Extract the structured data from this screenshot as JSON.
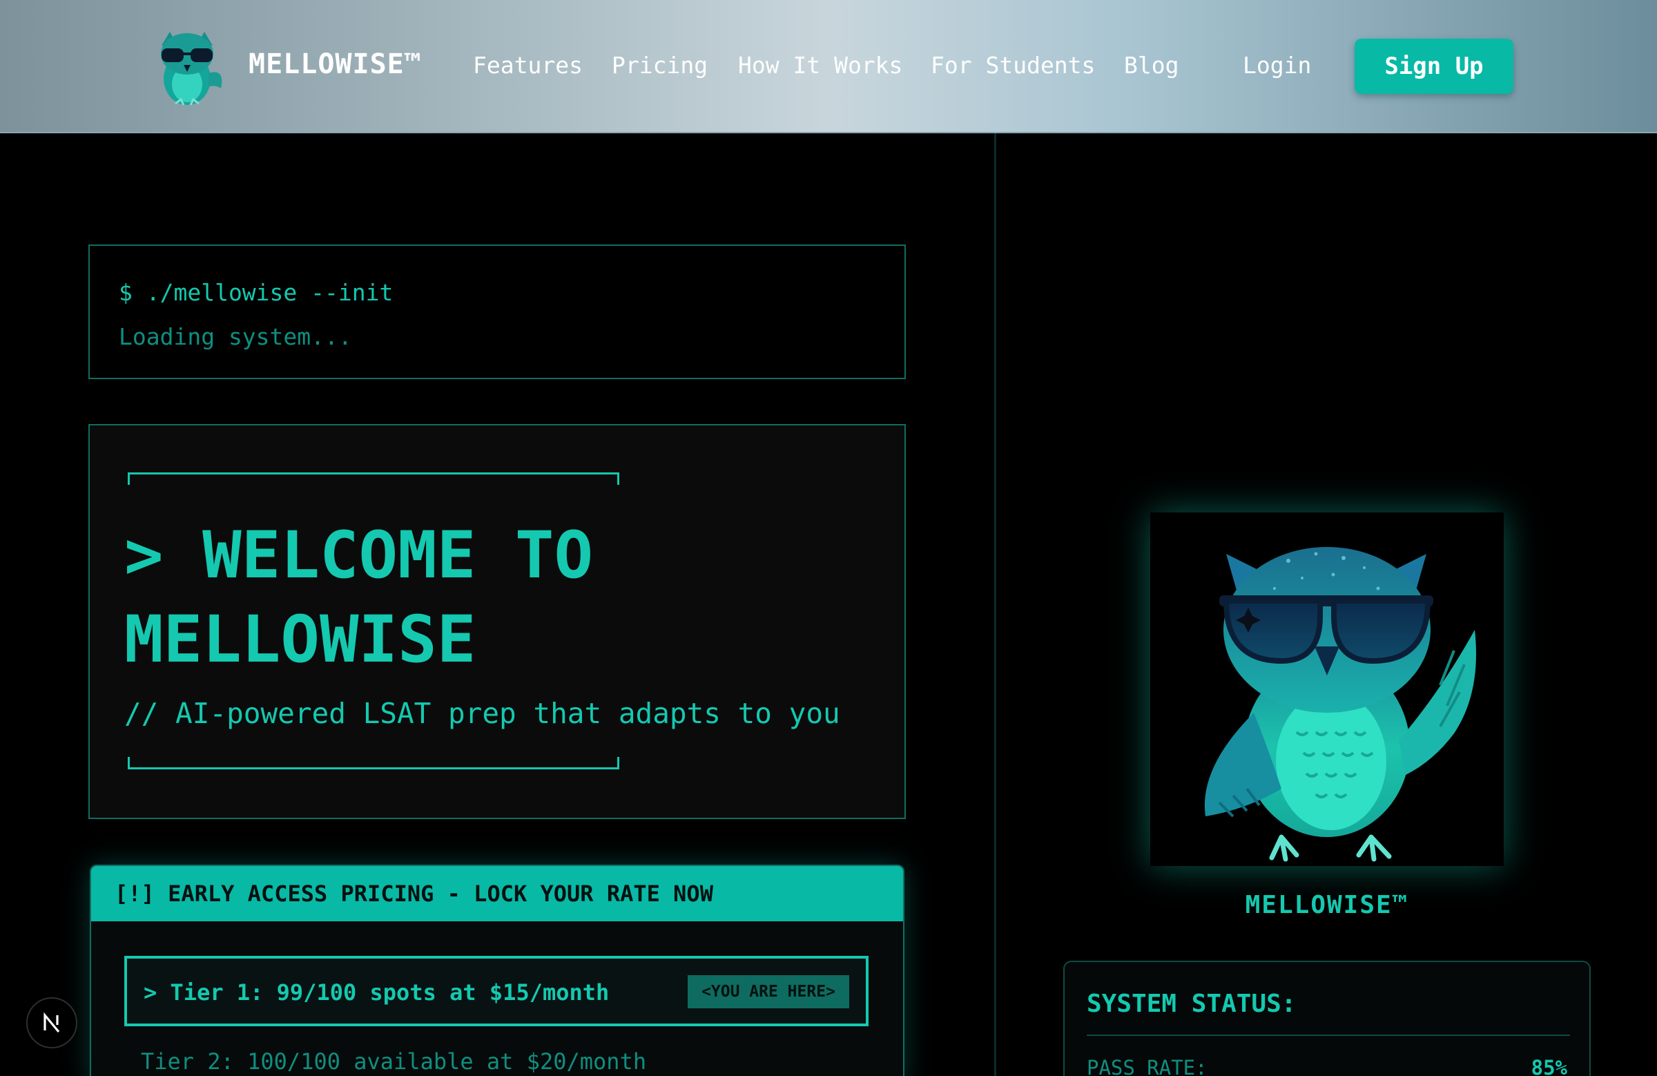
{
  "nav": {
    "brand": "MELLOWISE™",
    "links": [
      "Features",
      "Pricing",
      "How It Works",
      "For Students",
      "Blog"
    ],
    "login_label": "Login",
    "signup_label": "Sign Up"
  },
  "terminal": {
    "command": "$ ./mellowise --init",
    "loading": "Loading system..."
  },
  "hero": {
    "title_line1": "> WELCOME TO",
    "title_line2": "MELLOWISE",
    "subtitle": "// AI-powered LSAT prep that adapts to you"
  },
  "pricing": {
    "header": "[!] EARLY ACCESS PRICING - LOCK YOUR RATE NOW",
    "tier1": "> Tier 1: 99/100 spots at $15/month",
    "tier1_badge": "<YOU ARE HERE>",
    "tier2": "Tier 2: 100/100 available at $20/month"
  },
  "mascot": {
    "caption": "MELLOWISE™"
  },
  "status": {
    "title": "SYSTEM STATUS:",
    "rows": [
      {
        "key": "PASS_RATE:",
        "value": "85%"
      }
    ]
  },
  "colors": {
    "accent": "#14c9b0",
    "accent_button": "#08b9a6",
    "background": "#000000",
    "panel": "#0b0b0b",
    "border": "#0f6e64"
  },
  "icons": {
    "logo": "owl-logo-icon",
    "mascot": "owl-mascot-icon",
    "nextjs": "nextjs-icon"
  }
}
